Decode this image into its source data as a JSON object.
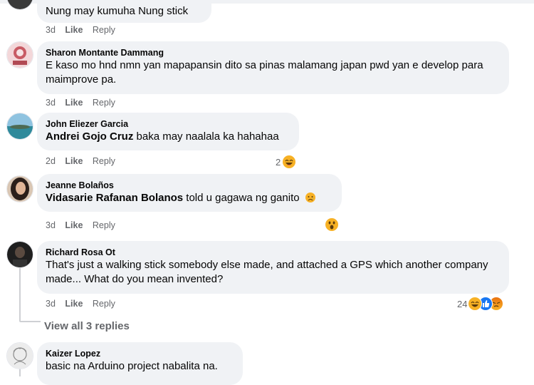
{
  "comments": [
    {
      "name": "",
      "text": "Nung may kumuha Nung stick",
      "time": "3d",
      "like": "Like",
      "reply": "Reply"
    },
    {
      "name": "Sharon Montante Dammang",
      "text": "E kaso mo hnd nmn yan mapapansin dito sa pinas malamang japan pwd yan e develop para maimprove pa.",
      "time": "3d",
      "like": "Like",
      "reply": "Reply"
    },
    {
      "name": "John Eliezer Garcia",
      "mention": "Andrei Gojo Cruz",
      "text": " baka may naalala ka hahahaa",
      "time": "2d",
      "like": "Like",
      "reply": "Reply",
      "reaction_count": "2",
      "reaction_icons": [
        "haha-emoji"
      ]
    },
    {
      "name": "Jeanne Bolaños",
      "mention": "Vidasarie Rafanan Bolanos",
      "text": " told u gagawa ng ganito",
      "inline_icon": "sad-emoji",
      "time": "3d",
      "like": "Like",
      "reply": "Reply",
      "reaction_icons": [
        "wow-emoji"
      ]
    },
    {
      "name": "Richard Rosa Ot",
      "text": "That's just a walking stick somebody else made, and attached a GPS which another company made... What do you mean invented?",
      "time": "3d",
      "like": "Like",
      "reply": "Reply",
      "reaction_count": "24",
      "reaction_icons": [
        "haha-emoji",
        "like-icon",
        "angry-emoji"
      ]
    },
    {
      "name": "Kaizer Lopez",
      "text": "basic na Arduino project nabalita na."
    }
  ],
  "view_replies": "View all 3 replies",
  "colors": {
    "bubble": "#f0f2f5",
    "meta": "#65676b",
    "like_blue": "#1877f2",
    "emoji_yellow": "#f7b125",
    "angry_red": "#e9710f"
  }
}
